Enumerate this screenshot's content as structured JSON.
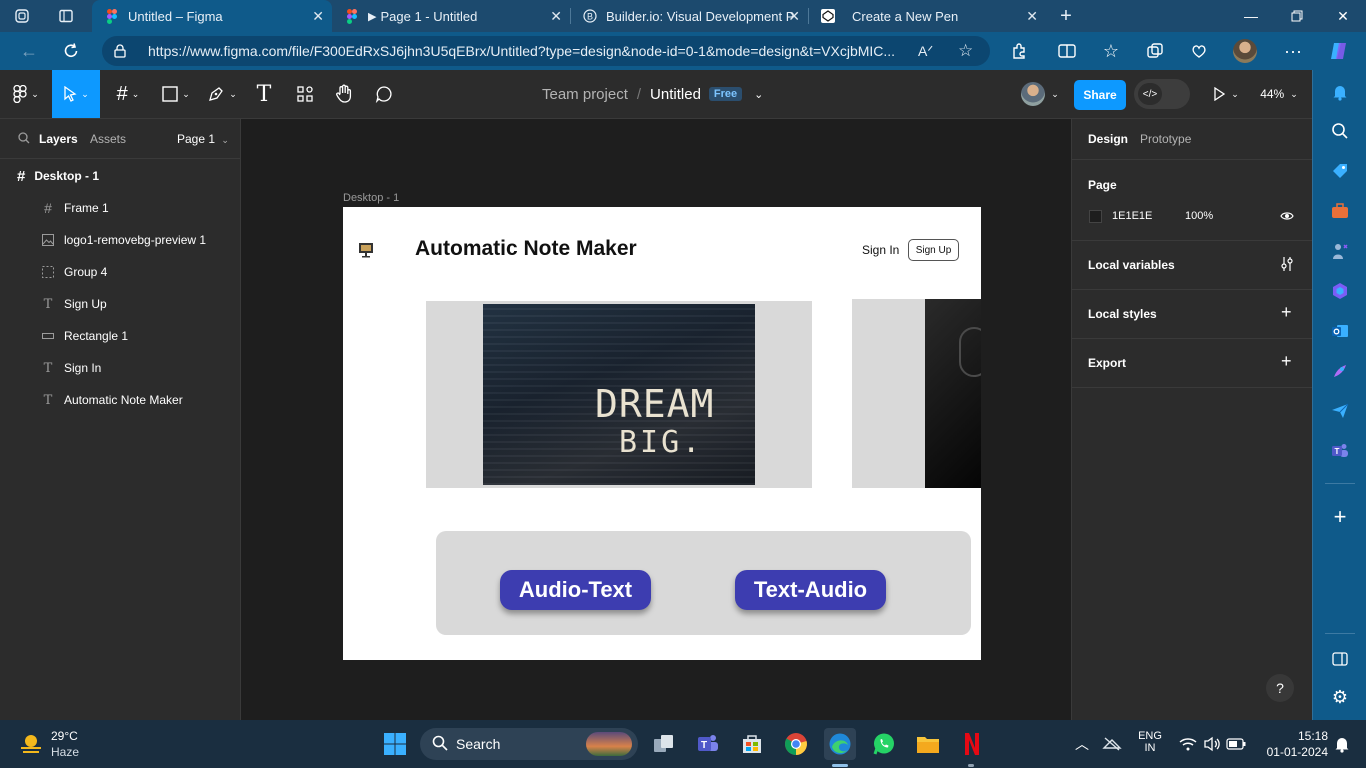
{
  "browser": {
    "tabs": [
      {
        "title": "Untitled – Figma",
        "active": true
      },
      {
        "title": "Page 1 - Untitled",
        "active": false
      },
      {
        "title": "Builder.io: Visual Development P",
        "active": false
      },
      {
        "title": "Create a New Pen",
        "active": false
      }
    ],
    "url": "https://www.figma.com/file/F300EdRxSJ6jhn3U5qEBrx/Untitled?type=design&node-id=0-1&mode=design&t=VXcjbMIC..."
  },
  "figma": {
    "breadcrumb": {
      "team": "Team project",
      "separator": "/",
      "file": "Untitled",
      "plan_badge": "Free"
    },
    "share_label": "Share",
    "zoom": "44%",
    "left_panel": {
      "tabs": [
        "Layers",
        "Assets"
      ],
      "page_selector": "Page 1",
      "root_frame": "Desktop - 1",
      "layers": [
        {
          "name": "Frame 1",
          "icon": "frame-icon"
        },
        {
          "name": "logo1-removebg-preview 1",
          "icon": "image-icon"
        },
        {
          "name": "Group 4",
          "icon": "group-icon"
        },
        {
          "name": "Sign Up",
          "icon": "text-icon"
        },
        {
          "name": "Rectangle 1",
          "icon": "rectangle-icon"
        },
        {
          "name": "Sign In",
          "icon": "text-icon"
        },
        {
          "name": "Automatic Note Maker",
          "icon": "text-icon"
        }
      ]
    },
    "canvas": {
      "frame_label": "Desktop - 1",
      "design": {
        "title": "Automatic Note Maker",
        "sign_in": "Sign In",
        "sign_up": "Sign Up",
        "hero_image_text_line1": "DREAM",
        "hero_image_text_line2": "BIG.",
        "button_audio_text": "Audio-Text",
        "button_text_audio": "Text-Audio"
      }
    },
    "right_panel": {
      "tabs": [
        "Design",
        "Prototype"
      ],
      "page_section": {
        "title": "Page",
        "color_hex": "1E1E1E",
        "opacity": "100%"
      },
      "local_variables": "Local variables",
      "local_styles": "Local styles",
      "export": "Export",
      "help": "?"
    }
  },
  "taskbar": {
    "weather_temp": "29°C",
    "weather_desc": "Haze",
    "search_placeholder": "Search",
    "lang_line1": "ENG",
    "lang_line2": "IN",
    "time": "15:18",
    "date": "01-01-2024"
  },
  "colors": {
    "figma_accent": "#0d99ff",
    "design_button": "#3d3db0",
    "edge_chrome": "#0f5a8a"
  }
}
